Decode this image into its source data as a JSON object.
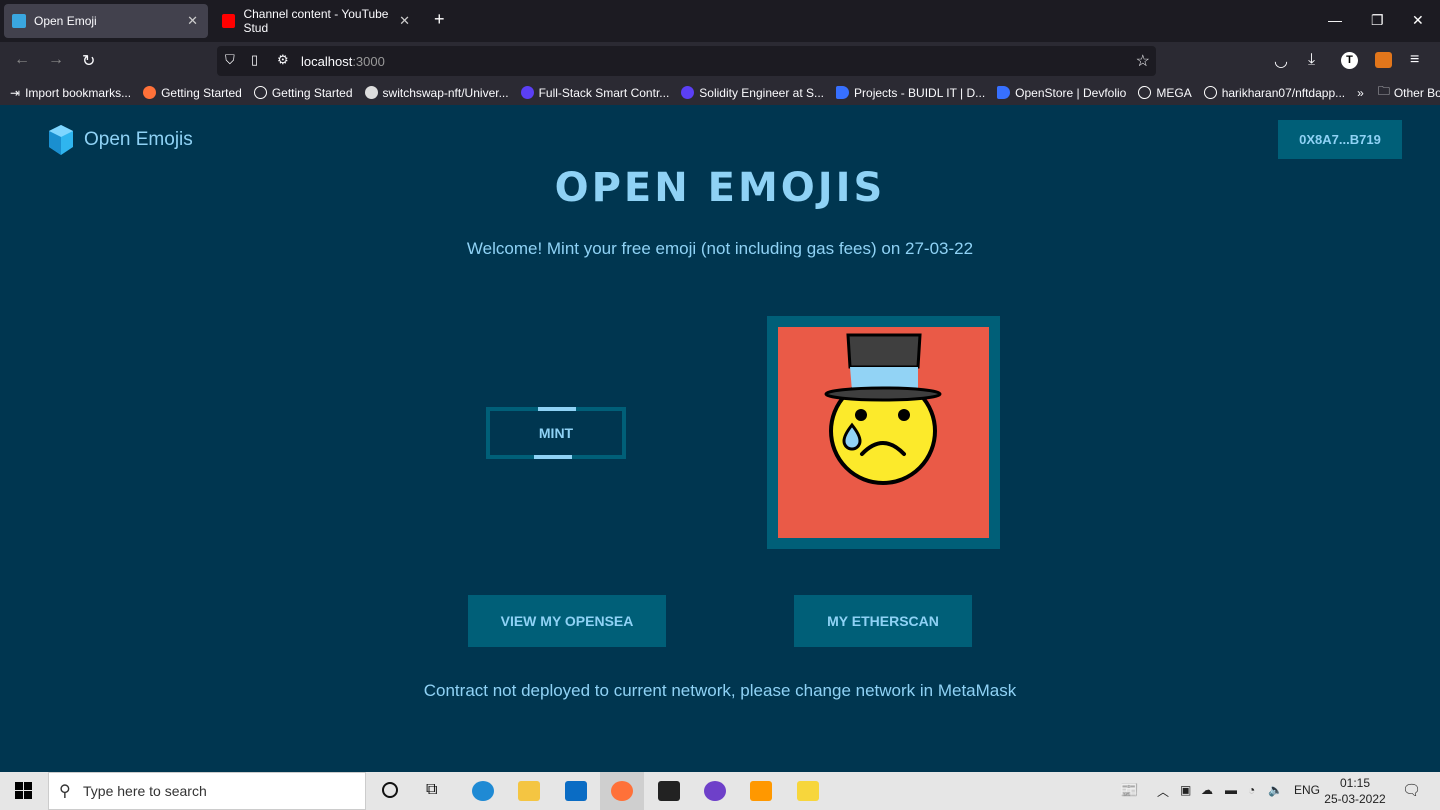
{
  "browser": {
    "tabs": [
      {
        "label": "Open Emoji",
        "active": true
      },
      {
        "label": "Channel content - YouTube Stud",
        "active": false
      }
    ],
    "url_host": "localhost",
    "url_port": ":3000",
    "bookmarks": [
      "Import bookmarks...",
      "Getting Started",
      "Getting Started",
      "switchswap-nft/Univer...",
      "Full-Stack Smart Contr...",
      "Solidity Engineer at S...",
      "Projects - BUIDL IT | D...",
      "OpenStore | Devfolio",
      "MEGA",
      "harikharan07/nftdapp..."
    ],
    "other_bookmarks": "Other Bookmarks",
    "profile_initial": "T"
  },
  "app": {
    "brand": "Open Emojis",
    "wallet": "0X8A7...B719",
    "title": "OPEN EMOJIS",
    "welcome": "Welcome! Mint your free emoji (not including gas fees) on 27-03-22",
    "mint_label": "MINT",
    "opensea_label": "VIEW MY OPENSEA",
    "etherscan_label": "MY ETHERSCAN",
    "status": "Contract not deployed to current network, please change network in MetaMask",
    "colors": {
      "background": "#003650",
      "panel": "#005f78",
      "accent": "#8fd2f5",
      "emoji_bg": "#ea5a47"
    }
  },
  "taskbar": {
    "search_placeholder": "Type here to search",
    "lang": "ENG",
    "time": "01:15",
    "date": "25-03-2022"
  }
}
